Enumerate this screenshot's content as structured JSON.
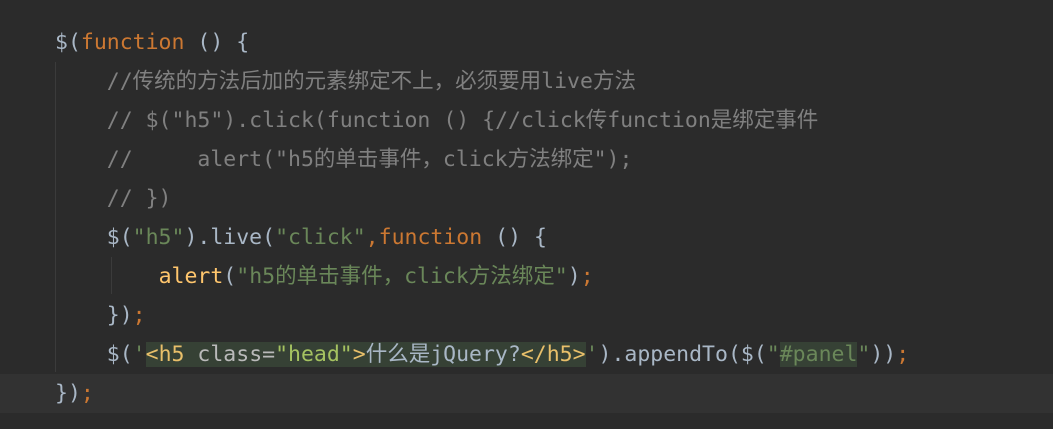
{
  "editor": {
    "language": "JavaScript (jQuery)",
    "theme": "dark",
    "lines": [
      {
        "tokens": [
          {
            "t": "$(",
            "k": "op"
          },
          {
            "t": "function",
            "k": "kw"
          },
          {
            "t": " () {",
            "k": "op"
          }
        ]
      },
      {
        "tokens": [
          {
            "t": "    //传统的方法后加的元素绑定不上，必须要用live方法",
            "k": "cm"
          }
        ]
      },
      {
        "tokens": [
          {
            "t": "    // $(\"h5\").click(function () {//click传function是绑定事件",
            "k": "cm"
          }
        ]
      },
      {
        "tokens": [
          {
            "t": "    //     alert(\"h5的单击事件，click方法绑定\");",
            "k": "cm"
          }
        ]
      },
      {
        "tokens": [
          {
            "t": "    // })",
            "k": "cm"
          }
        ]
      },
      {
        "tokens": [
          {
            "t": "    $(",
            "k": "op"
          },
          {
            "t": "\"h5\"",
            "k": "str"
          },
          {
            "t": ").live(",
            "k": "op"
          },
          {
            "t": "\"click\"",
            "k": "str"
          },
          {
            "t": ",",
            "k": "semi"
          },
          {
            "t": "function",
            "k": "kw"
          },
          {
            "t": " () {",
            "k": "op"
          }
        ]
      },
      {
        "tokens": [
          {
            "t": "        ",
            "k": "op"
          },
          {
            "t": "alert",
            "k": "fn"
          },
          {
            "t": "(",
            "k": "op"
          },
          {
            "t": "\"h5的单击事件，click方法绑定\"",
            "k": "str"
          },
          {
            "t": ")",
            "k": "op"
          },
          {
            "t": ";",
            "k": "semi"
          }
        ]
      },
      {
        "tokens": [
          {
            "t": "    })",
            "k": "op"
          },
          {
            "t": ";",
            "k": "semi"
          }
        ]
      },
      {
        "tokens": [
          {
            "t": "    $(",
            "k": "op"
          },
          {
            "t": "'",
            "k": "str"
          },
          {
            "t": "<h5",
            "k": "tag inj"
          },
          {
            "t": " class=",
            "k": "attr inj"
          },
          {
            "t": "\"head\"",
            "k": "attrval inj"
          },
          {
            "t": ">",
            "k": "tag inj"
          },
          {
            "t": "什么是jQuery?",
            "k": "op inj"
          },
          {
            "t": "</h5>",
            "k": "tag inj"
          },
          {
            "t": "'",
            "k": "str"
          },
          {
            "t": ").appendTo($(",
            "k": "op"
          },
          {
            "t": "\"",
            "k": "str"
          },
          {
            "t": "#panel",
            "k": "str inj"
          },
          {
            "t": "\"",
            "k": "str"
          },
          {
            "t": "))",
            "k": "op"
          },
          {
            "t": ";",
            "k": "semi"
          }
        ]
      },
      {
        "current": true,
        "tokens": [
          {
            "t": "})",
            "k": "op"
          },
          {
            "t": ";",
            "k": "semi"
          }
        ]
      }
    ]
  }
}
